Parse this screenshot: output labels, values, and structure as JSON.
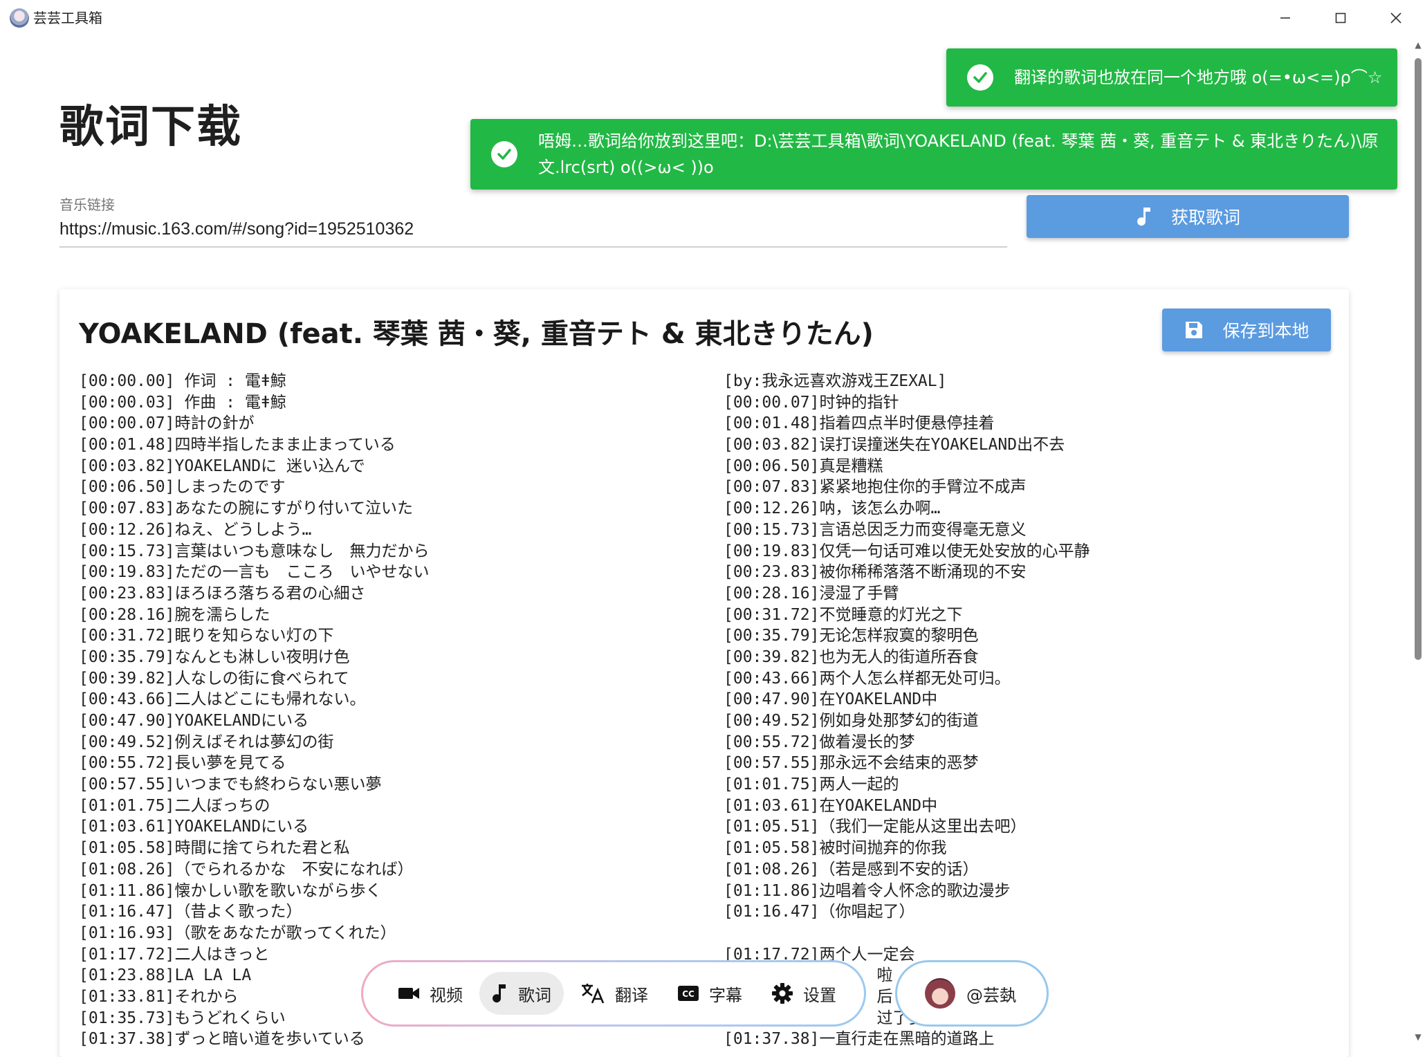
{
  "window": {
    "title": "芸芸工具箱",
    "minimize_glyph": "─",
    "maximize_glyph": "☐",
    "close_glyph": "✕"
  },
  "page": {
    "title": "歌词下载"
  },
  "music_link": {
    "label": "音乐链接",
    "value": "https://music.163.com/#/song?id=1952510362"
  },
  "fetch_button": {
    "label": "获取歌词",
    "icon": "music-note-icon"
  },
  "song": {
    "title": "YOAKELAND (feat. 琴葉 茜・葵, 重音テト & 東北きりたん)"
  },
  "save_button": {
    "label": "保存到本地",
    "icon": "save-icon"
  },
  "lyrics": {
    "original": [
      "[00:00.00] 作词 : 電ǂ鯨",
      "[00:00.03] 作曲 : 電ǂ鯨",
      "[00:00.07]時計の針が",
      "[00:01.48]四時半指したまま止まっている",
      "[00:03.82]YOAKELANDに 迷い込んで",
      "[00:06.50]しまったのです",
      "[00:07.83]あなたの腕にすがり付いて泣いた",
      "[00:12.26]ねえ、どうしよう…",
      "[00:15.73]言葉はいつも意味なし　無力だから",
      "[00:19.83]ただの一言も　こころ　いやせない",
      "[00:23.83]ほろほろ落ちる君の心細さ",
      "[00:28.16]腕を濡らした",
      "[00:31.72]眠りを知らない灯の下",
      "[00:35.79]なんとも淋しい夜明け色",
      "[00:39.82]人なしの街に食べられて",
      "[00:43.66]二人はどこにも帰れない。",
      "[00:47.90]YOAKELANDにいる",
      "[00:49.52]例えばそれは夢幻の街",
      "[00:55.72]長い夢を見てる",
      "[00:57.55]いつまでも終わらない悪い夢",
      "[01:01.75]二人ぼっちの",
      "[01:03.61]YOAKELANDにいる",
      "[01:05.58]時間に捨てられた君と私",
      "[01:08.26]（でられるかな　不安になれば）",
      "[01:11.86]懐かしい歌を歌いながら歩く",
      "[01:16.47]（昔よく歌った）",
      "[01:16.93]（歌をあなたが歌ってくれた）",
      "[01:17.72]二人はきっと",
      "[01:23.88]LA LA LA",
      "[01:33.81]それから",
      "[01:35.73]もうどれくらい",
      "[01:37.38]ずっと暗い道を歩いている"
    ],
    "translation": [
      "[by:我永远喜欢游戏王ZEXAL]",
      "[00:00.07]时钟的指针",
      "[00:01.48]指着四点半时便悬停挂着",
      "[00:03.82]误打误撞迷失在YOAKELAND出不去",
      "[00:06.50]真是糟糕",
      "[00:07.83]紧紧地抱住你的手臂泣不成声",
      "[00:12.26]呐，该怎么办啊…",
      "[00:15.73]言语总因乏力而变得毫无意义",
      "[00:19.83]仅凭一句话可难以使无处安放的心平静",
      "[00:23.83]被你稀稀落落不断涌现的不安",
      "[00:28.16]浸湿了手臂",
      "[00:31.72]不觉睡意的灯光之下",
      "[00:35.79]无论怎样寂寞的黎明色",
      "[00:39.82]也为无人的街道所吞食",
      "[00:43.66]两个人怎么样都无处可归。",
      "[00:47.90]在YOAKELAND中",
      "[00:49.52]例如身处那梦幻的街道",
      "[00:55.72]做着漫长的梦",
      "[00:57.55]那永远不会结束的恶梦",
      "[01:01.75]两人一起的",
      "[01:03.61]在YOAKELAND中",
      "[01:05.51]（我们一定能从这里出去吧）",
      "[01:05.58]被时间抛弃的你我",
      "[01:08.26]（若是感到不安的话）",
      "[01:11.86]边唱着令人怀念的歌边漫步",
      "[01:16.47]（你唱起了）",
      "",
      "[01:17.72]两个人一定会",
      "                啦",
      "                后",
      "                过了多",
      "[01:37.38]一直行走在黑暗的道路上"
    ]
  },
  "toasts": [
    {
      "text": "翻译的歌词也放在同一个地方哦 o(=•ω<=)ρ⌒☆",
      "icon": "check-circle-icon"
    },
    {
      "text": "唔姆…歌词给你放到这里吧：D:\\芸芸工具箱\\歌词\\YOAKELAND (feat. 琴葉 茜・葵, 重音テト & 東北きりたん)\\原文.lrc(srt) o((>ω< ))o",
      "icon": "check-circle-icon"
    }
  ],
  "nav": {
    "items": [
      {
        "label": "视频",
        "icon": "video-camera-icon"
      },
      {
        "label": "歌词",
        "icon": "music-note-icon",
        "active": true
      },
      {
        "label": "翻译",
        "icon": "translate-icon"
      },
      {
        "label": "字幕",
        "icon": "closed-caption-icon"
      },
      {
        "label": "设置",
        "icon": "gear-icon"
      }
    ],
    "user": {
      "name": "@芸埶",
      "icon": "avatar"
    }
  },
  "colors": {
    "primary_button": "#5b9be0",
    "toast_success": "#22b845",
    "nav_active": "#ebebeb"
  }
}
